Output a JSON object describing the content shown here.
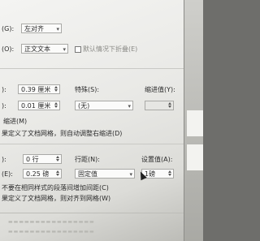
{
  "general": {
    "alignment_label": "(G):",
    "alignment_value": "左对齐",
    "outline_label": "(O):",
    "outline_value": "正文文本",
    "collapsed_label": "默认情况下折叠(E)"
  },
  "indent": {
    "left_label": "):",
    "left_value": "0.39 厘米",
    "right_label": "):",
    "right_value": "0.01 厘米",
    "special_label": "特殊(S):",
    "special_value": "(无)",
    "indent_value_label": "缩进值(Y):",
    "mirror_label": "缩进(M)",
    "auto_adjust_label": "果定义了文档网格，则自动调整右缩进(D)"
  },
  "spacing": {
    "before_label": "):",
    "before_value": "0 行",
    "after_label": "(E):",
    "after_value": "0.25 磅",
    "line_spacing_label": "行距(N):",
    "line_spacing_value": "固定值",
    "at_label": "设置值(A):",
    "at_value": "1磅",
    "no_space_label": "不要在相同样式的段落间增加间距(C)",
    "snap_grid_label": "果定义了文档网格，则对齐到网格(W)"
  },
  "icons": [
    "dropdown-arrow-icon",
    "spinner-icon",
    "checkbox-icon",
    "mouse-cursor-icon"
  ]
}
